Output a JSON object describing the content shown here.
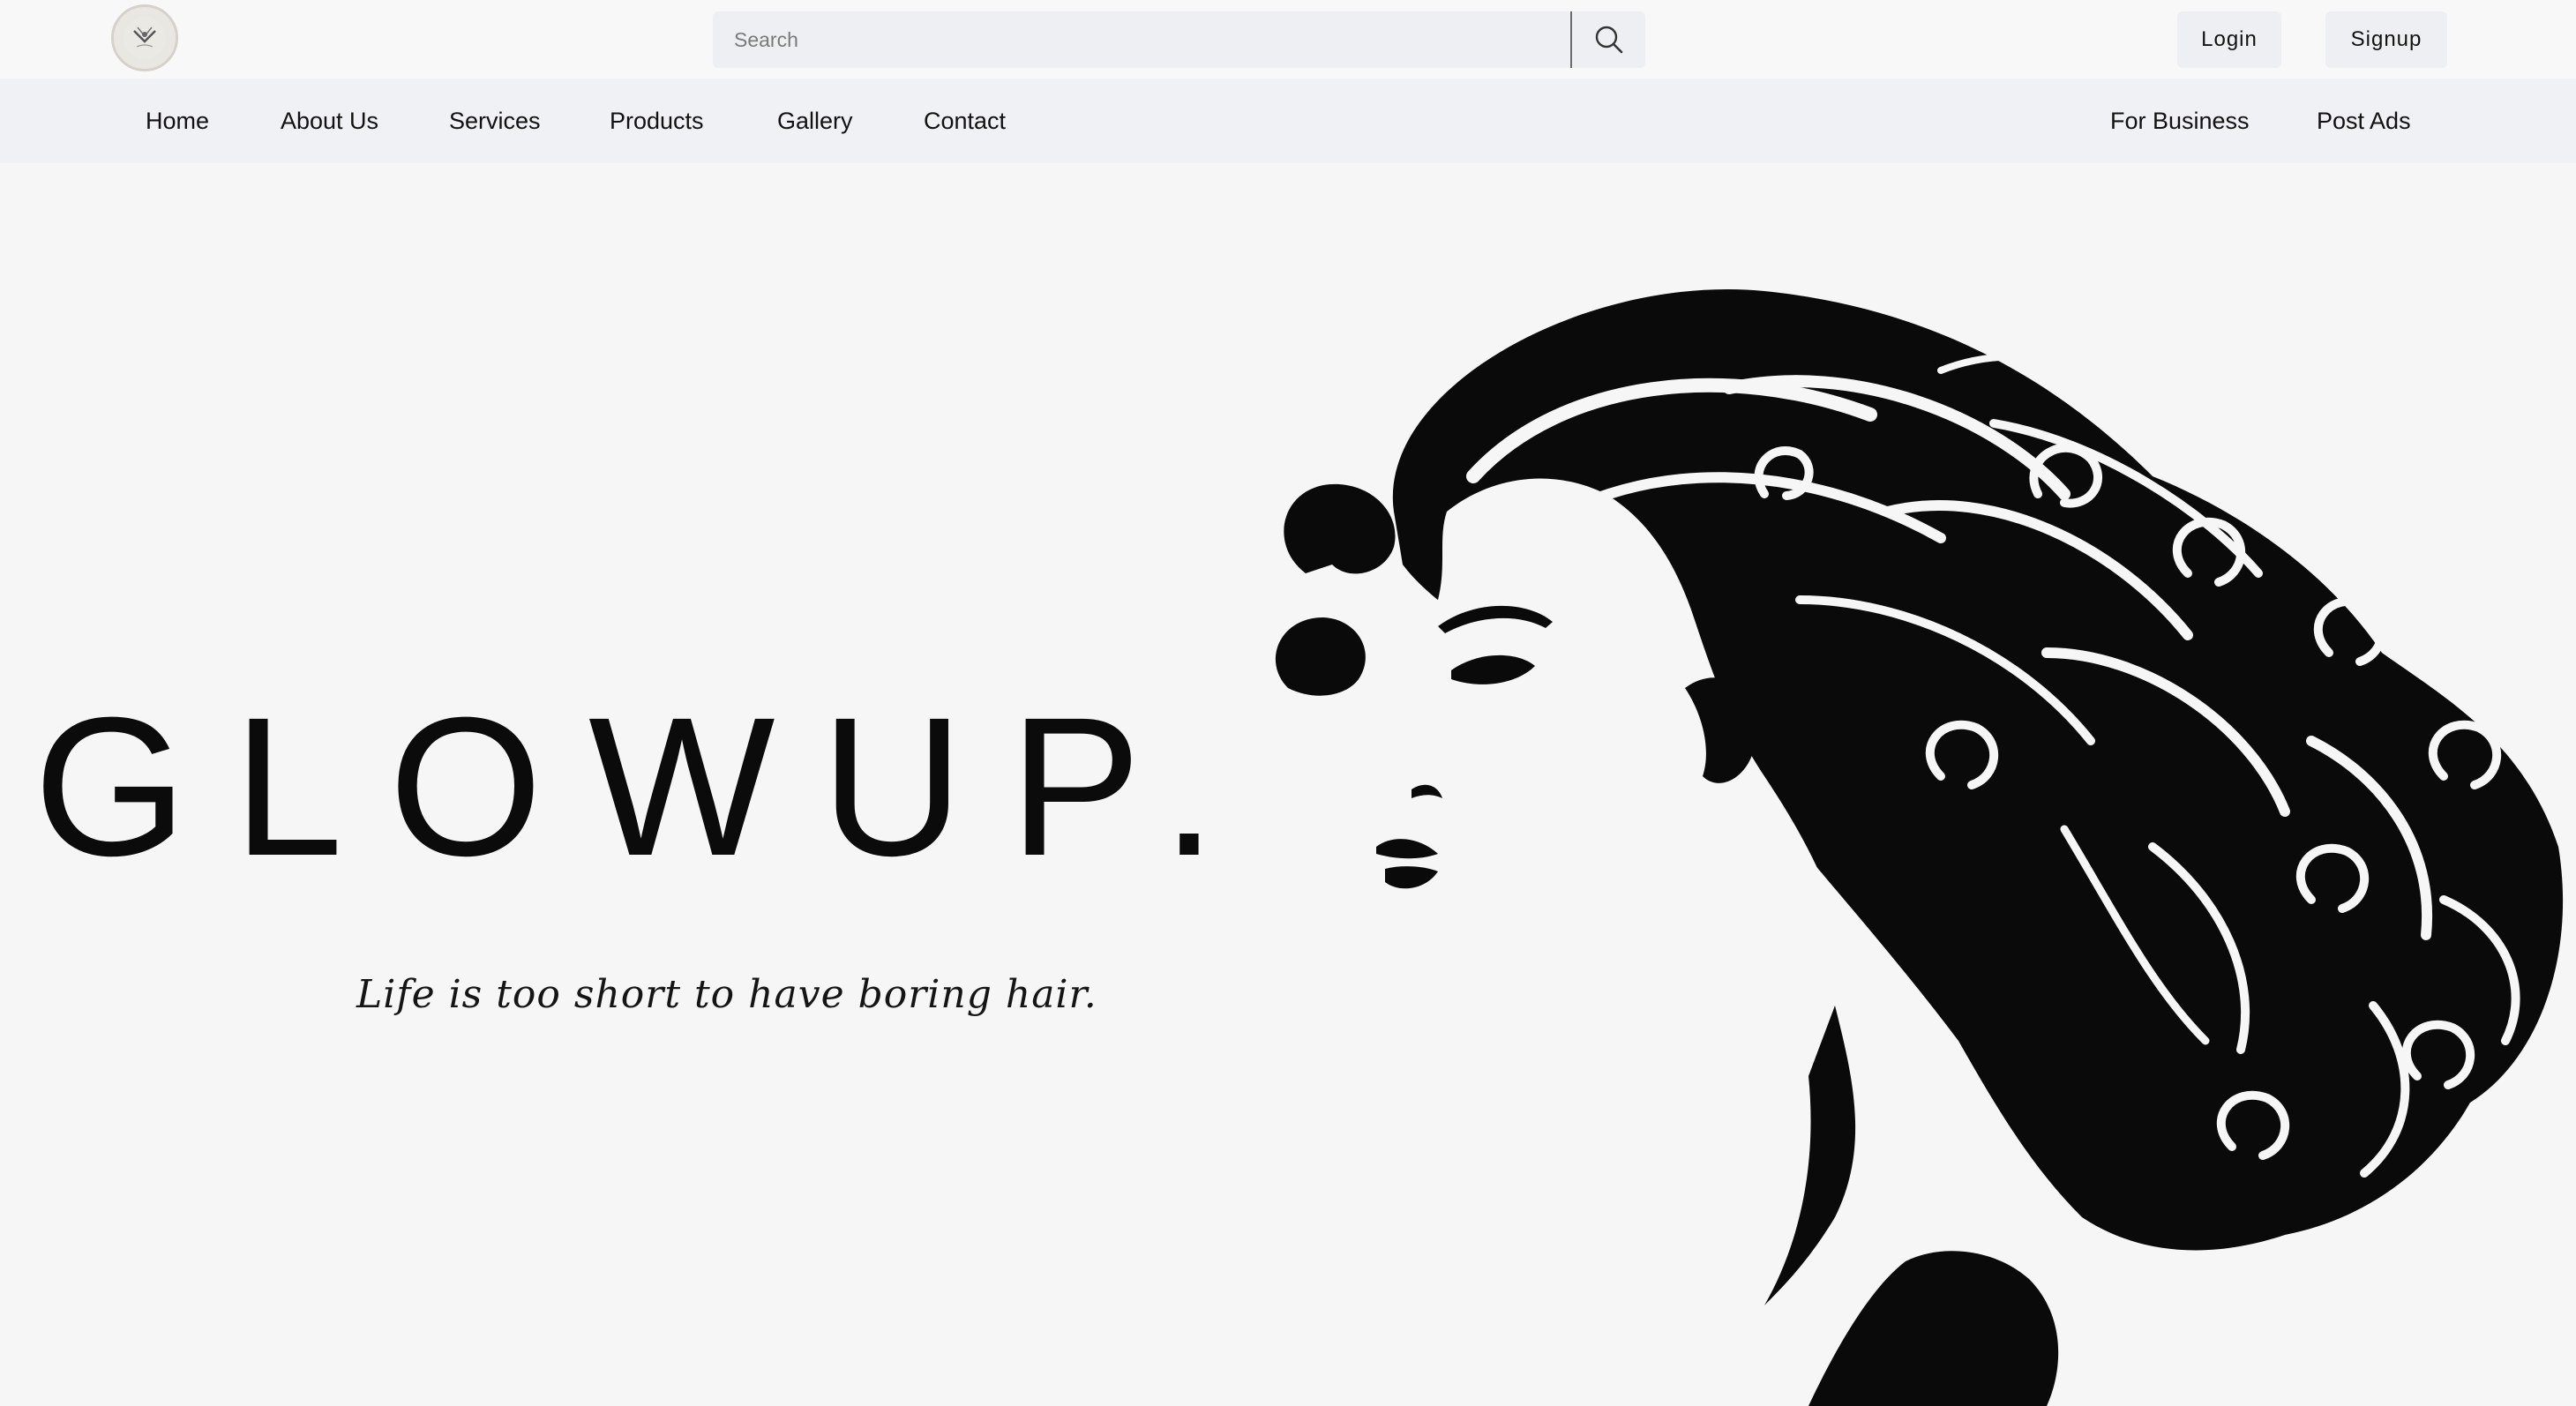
{
  "header": {
    "logo_icon": "salon-logo-icon",
    "search": {
      "placeholder": "Search",
      "value": "",
      "button_icon": "search-icon"
    },
    "login_label": "Login",
    "signup_label": "Signup"
  },
  "nav": {
    "left": [
      {
        "label": "Home"
      },
      {
        "label": "About Us"
      },
      {
        "label": "Services"
      },
      {
        "label": "Products"
      },
      {
        "label": "Gallery"
      },
      {
        "label": "Contact"
      }
    ],
    "right": [
      {
        "label": "For Business"
      },
      {
        "label": "Post Ads"
      }
    ]
  },
  "hero": {
    "title": "GLOWUP.",
    "tagline": "Life is too short to have boring hair.",
    "illustration": "woman-profile-curly-hair-illustration"
  },
  "colors": {
    "background": "#f6f6f6",
    "navbar": "#f0f1f4",
    "button_bg": "#eeeff2",
    "text": "#111111"
  }
}
